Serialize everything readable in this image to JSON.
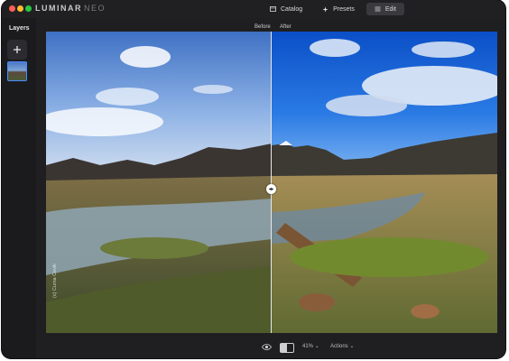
{
  "app": {
    "logo_main": "LUMINAR",
    "logo_sub": "NEO"
  },
  "tabs": [
    {
      "label": "Catalog",
      "icon": "catalog-icon"
    },
    {
      "label": "Presets",
      "icon": "presets-icon"
    },
    {
      "label": "Edit",
      "icon": "edit-icon",
      "active": true
    }
  ],
  "sidebar": {
    "title": "Layers",
    "add_icon": "plus-icon"
  },
  "compare": {
    "before_label": "Before",
    "after_label": "After",
    "divider_position": 0.5
  },
  "photo": {
    "watermark": "(c) Cuma Cevik"
  },
  "bottom": {
    "zoom": "41%",
    "zoom_caret": "⌄",
    "actions": "Actions",
    "actions_caret": "⌄"
  },
  "colors": {
    "accent": "#4a8cff",
    "window_bg": "#1f1f22"
  }
}
